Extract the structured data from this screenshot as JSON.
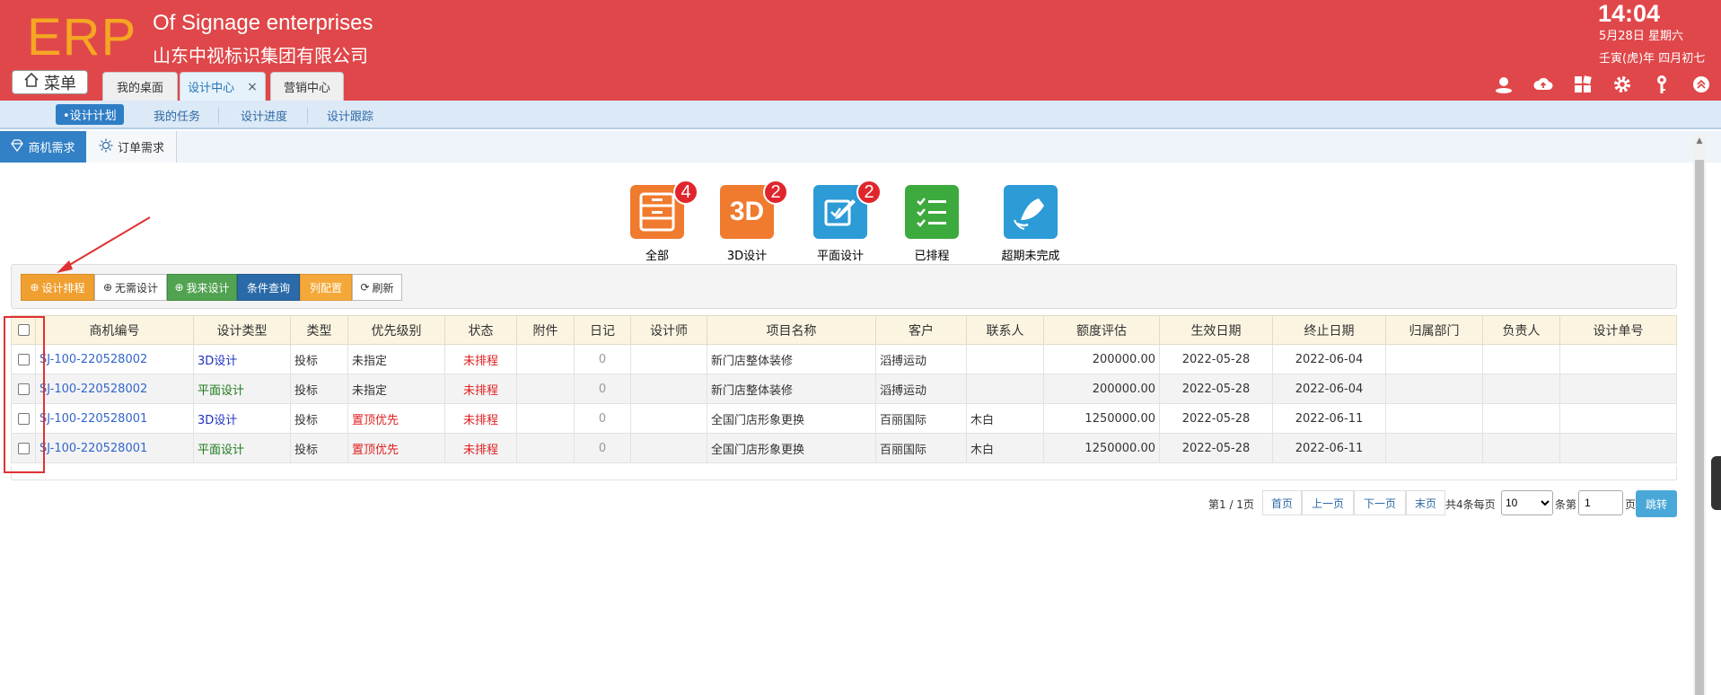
{
  "header": {
    "logo": "ERP",
    "company_en": "Of Signage enterprises",
    "company_cn": "山东中视标识集团有限公司",
    "time": "14:04",
    "date": "5月28日 星期六",
    "lunar": "壬寅(虎)年 四月初七",
    "menu_label": "菜单",
    "tabs": [
      {
        "label": "我的桌面",
        "active": false
      },
      {
        "label": "设计中心",
        "active": true,
        "close": "×"
      },
      {
        "label": "营销中心",
        "active": false
      }
    ],
    "icons": [
      "user-icon",
      "cloud-upload-icon",
      "grid-icon",
      "gear-icon",
      "key-icon",
      "collapse-icon"
    ]
  },
  "subnav": {
    "items": [
      "•设计计划",
      "我的任务",
      "设计进度",
      "设计跟踪"
    ]
  },
  "sectabs": {
    "active": "商机需求",
    "normal": "订单需求"
  },
  "status_icons": [
    {
      "label": "全部",
      "badge": "4",
      "icon": "cabinet-icon",
      "color": "#f07a2e"
    },
    {
      "label": "3D设计",
      "badge": "2",
      "icon": "3d-icon",
      "glyph": "3D",
      "color": "#f07a2e"
    },
    {
      "label": "平面设计",
      "badge": "2",
      "icon": "edit-icon",
      "color": "#2c9bd6"
    },
    {
      "label": "已排程",
      "badge": "",
      "icon": "checklist-icon",
      "color": "#3daa3d"
    },
    {
      "label": "超期未完成",
      "badge": "",
      "icon": "bell-icon",
      "color": "#2c9bd6"
    }
  ],
  "toolbar": {
    "schedule": "设计排程",
    "no_design": "无需设计",
    "my_design": "我来设计",
    "query": "条件查询",
    "config": "列配置",
    "refresh": "刷新"
  },
  "table": {
    "headers": [
      "商机编号",
      "设计类型",
      "类型",
      "优先级别",
      "状态",
      "附件",
      "日记",
      "设计师",
      "项目名称",
      "客户",
      "联系人",
      "额度评估",
      "生效日期",
      "终止日期",
      "归属部门",
      "负责人",
      "设计单号"
    ],
    "rows": [
      {
        "code": "SJ-100-220528002",
        "design_type": "3D设计",
        "type": "投标",
        "priority": "未指定",
        "status": "未排程",
        "attach": "",
        "diary": "0",
        "designer": "",
        "project": "新门店整体装修",
        "customer": "滔搏运动",
        "contact": "",
        "amount": "200000.00",
        "start": "2022-05-28",
        "end": "2022-06-04",
        "dept": "",
        "owner": "",
        "design_no": ""
      },
      {
        "code": "SJ-100-220528002",
        "design_type": "平面设计",
        "type": "投标",
        "priority": "未指定",
        "status": "未排程",
        "attach": "",
        "diary": "0",
        "designer": "",
        "project": "新门店整体装修",
        "customer": "滔搏运动",
        "contact": "",
        "amount": "200000.00",
        "start": "2022-05-28",
        "end": "2022-06-04",
        "dept": "",
        "owner": "",
        "design_no": ""
      },
      {
        "code": "SJ-100-220528001",
        "design_type": "3D设计",
        "type": "投标",
        "priority": "置顶优先",
        "status": "未排程",
        "attach": "",
        "diary": "0",
        "designer": "",
        "project": "全国门店形象更换",
        "customer": "百丽国际",
        "contact": "木白",
        "amount": "1250000.00",
        "start": "2022-05-28",
        "end": "2022-06-11",
        "dept": "",
        "owner": "",
        "design_no": ""
      },
      {
        "code": "SJ-100-220528001",
        "design_type": "平面设计",
        "type": "投标",
        "priority": "置顶优先",
        "status": "未排程",
        "attach": "",
        "diary": "0",
        "designer": "",
        "project": "全国门店形象更换",
        "customer": "百丽国际",
        "contact": "木白",
        "amount": "1250000.00",
        "start": "2022-05-28",
        "end": "2022-06-11",
        "dept": "",
        "owner": "",
        "design_no": ""
      }
    ]
  },
  "pager": {
    "page_info": "第1 / 1页",
    "first": "首页",
    "prev": "上一页",
    "next": "下一页",
    "last": "末页",
    "total": "共4条每页",
    "page_size": "10",
    "per": "条第",
    "page_input": "1",
    "page_unit": "页",
    "jump": "跳转"
  }
}
